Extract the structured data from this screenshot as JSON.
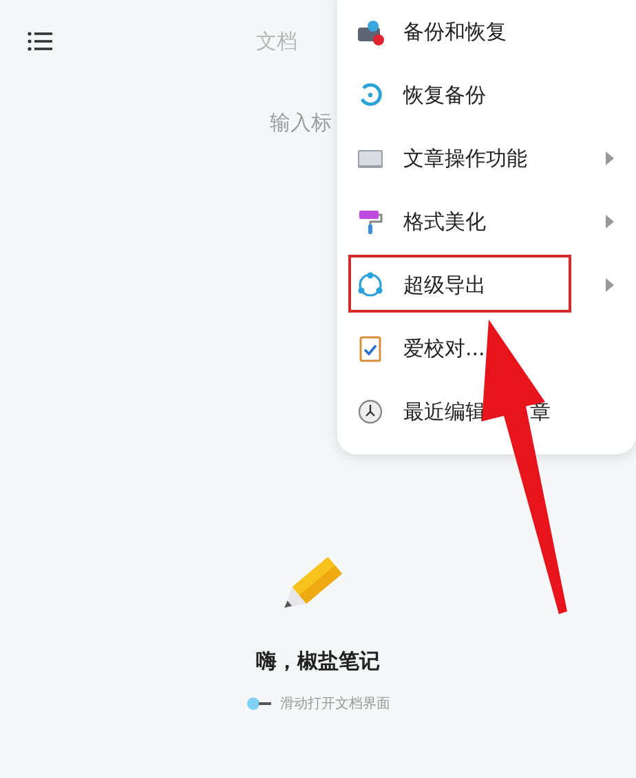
{
  "top_bar": {
    "tab": "文档",
    "title_placeholder": "输入标"
  },
  "menu": {
    "items": [
      {
        "label": "备份和恢复",
        "submenu": false,
        "annotated": false
      },
      {
        "label": "恢复备份",
        "submenu": false,
        "annotated": false
      },
      {
        "label": "文章操作功能",
        "submenu": true,
        "annotated": false
      },
      {
        "label": "格式美化",
        "submenu": true,
        "annotated": false
      },
      {
        "label": "超级导出",
        "submenu": true,
        "annotated": true
      },
      {
        "label": "爱校对...",
        "submenu": false,
        "annotated": false
      },
      {
        "label": "最近编辑",
        "label_after_arrow": "章",
        "submenu": false,
        "annotated": false
      }
    ]
  },
  "empty_state": {
    "title": "嗨，椒盐笔记",
    "hint": "滑动打开文档界面"
  }
}
